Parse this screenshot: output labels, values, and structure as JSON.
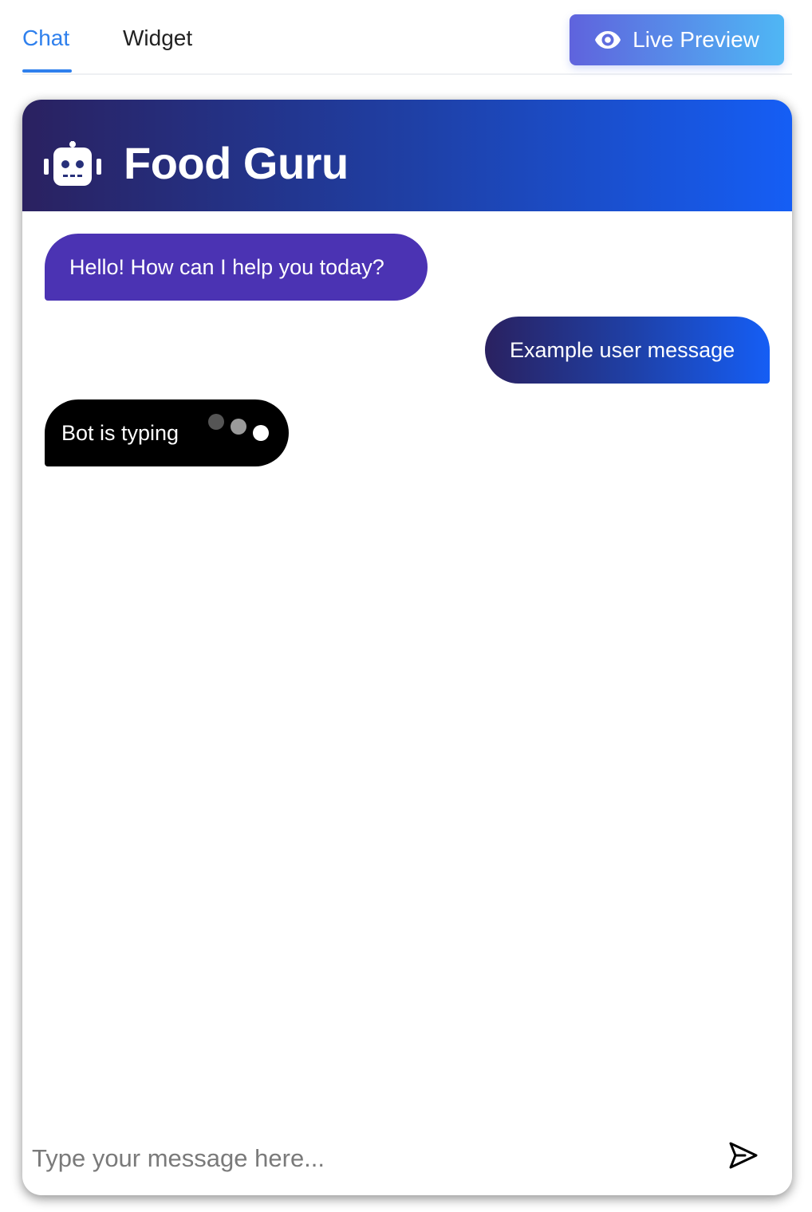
{
  "tabs": [
    {
      "label": "Chat",
      "active": true
    },
    {
      "label": "Widget",
      "active": false
    }
  ],
  "live_preview": {
    "label": "Live Preview",
    "icon": "eye-icon"
  },
  "chat": {
    "title": "Food Guru",
    "header_icon": "robot-icon",
    "messages": [
      {
        "sender": "bot",
        "text": "Hello! How can I help you today?"
      },
      {
        "sender": "user",
        "text": "Example user message"
      }
    ],
    "typing_text": "Bot is typing",
    "input_placeholder": "Type your message here...",
    "send_icon": "send-icon"
  },
  "colors": {
    "accent": "#2f80ed",
    "bot_bubble": "#4b33b3",
    "typing_bubble": "#000000",
    "header_gradient_start": "#2a2160",
    "header_gradient_end": "#155ef5",
    "preview_gradient_start": "#5f63dd",
    "preview_gradient_end": "#4fb7f5"
  }
}
